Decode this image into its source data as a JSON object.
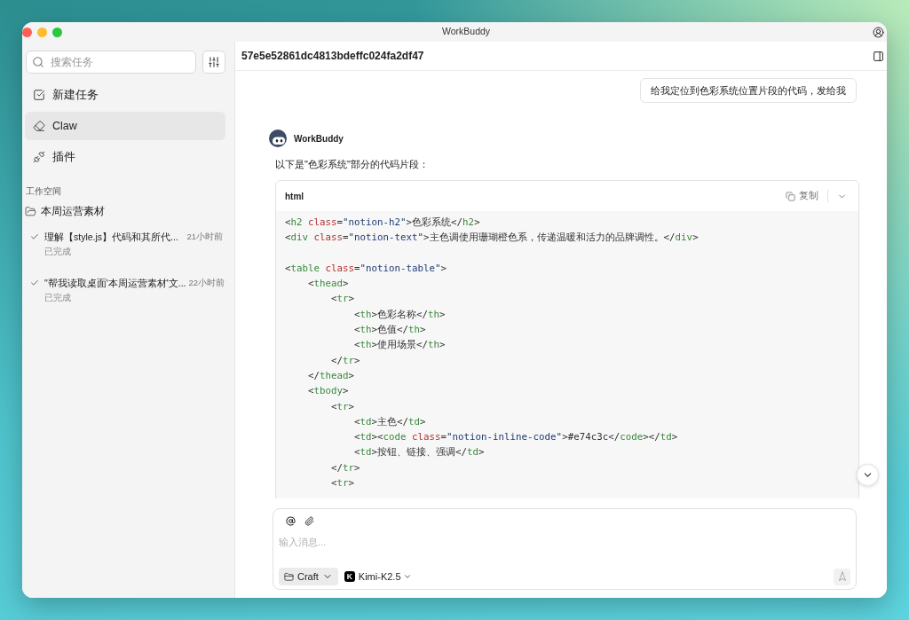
{
  "window": {
    "title": "WorkBuddy"
  },
  "sidebar": {
    "search": {
      "placeholder": "搜索任务"
    },
    "nav": [
      {
        "label": "新建任务",
        "kind": "new_task",
        "selected": false
      },
      {
        "label": "Claw",
        "kind": "claw",
        "selected": true
      },
      {
        "label": "插件",
        "kind": "plugins",
        "selected": false
      }
    ],
    "section_title": "工作空间",
    "folder": {
      "name": "本周运营素材"
    },
    "tasks": [
      {
        "title": "理解【style.js】代码和其所代...",
        "time": "21小时前",
        "status": "已完成",
        "done": true
      },
      {
        "title": "\"帮我读取桌面'本周运营素材'文...",
        "time": "22小时前",
        "status": "已完成",
        "done": true
      }
    ]
  },
  "header": {
    "title": "57e5e52861dc4813bdeffc024fa2df47"
  },
  "messages": [
    {
      "kind": "user",
      "text": "给我定位到色彩系统位置片段的代码，发给我"
    },
    {
      "kind": "assistant",
      "name": "WorkBuddy",
      "text": "以下是\"色彩系统\"部分的代码片段：",
      "code": {
        "language": "html",
        "copy_label": "复制",
        "blocks": [
          [
            "<h2 class=\"notion-h2\">色彩系统</h2>",
            "<div class=\"notion-text\">主色调使用珊瑚橙色系，传递温暖和活力的品牌调性。</div>"
          ],
          [
            "<table class=\"notion-table\">",
            "    <thead>",
            "        <tr>",
            "            <th>色彩名称</th>",
            "            <th>色值</th>",
            "            <th>使用场景</th>",
            "        </tr>",
            "    </thead>",
            "    <tbody>",
            "        <tr>",
            "            <td>主色</td>",
            "            <td><code class=\"notion-inline-code\">#e74c3c</code></td>",
            "            <td>按钮、链接、强调</td>",
            "        </tr>",
            "        <tr>"
          ]
        ]
      }
    }
  ],
  "composer": {
    "placeholder": "输入消息...",
    "mode": "Craft",
    "model": {
      "logo": "K",
      "name": "Kimi-K2.5"
    }
  }
}
